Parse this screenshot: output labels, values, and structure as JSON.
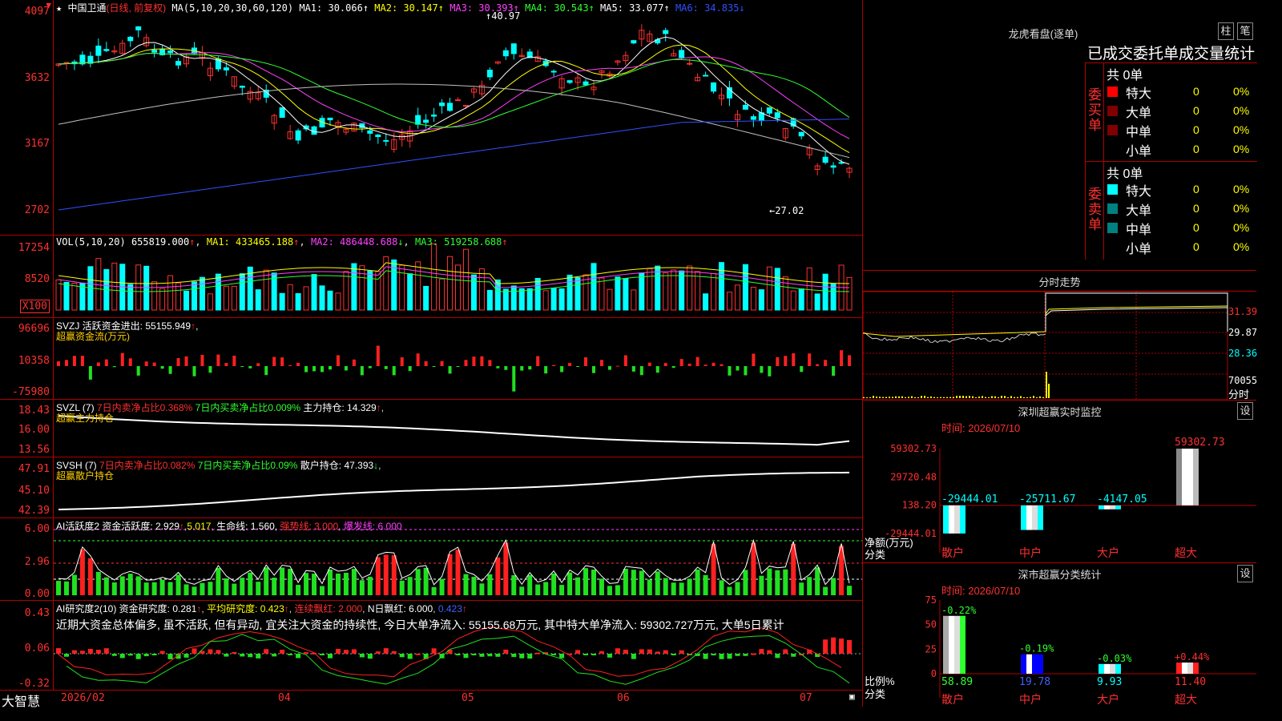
{
  "main": {
    "star": "★",
    "name": "中国卫通",
    "period": "(日线, 前复权)",
    "ma_label": "MA(5,10,20,30,60,120)",
    "ma": [
      {
        "label": "MA1:",
        "value": "30.066",
        "arrow": "↑",
        "color": "#ffffff"
      },
      {
        "label": "MA2:",
        "value": "30.147",
        "arrow": "↑",
        "color": "#ffff00"
      },
      {
        "label": "MA3:",
        "value": "30.393",
        "arrow": "↑",
        "color": "#ff40ff"
      },
      {
        "label": "MA4:",
        "value": "30.543",
        "arrow": "↑",
        "color": "#30ff30"
      },
      {
        "label": "MA5:",
        "value": "33.077",
        "arrow": "↑",
        "color": "#ffffff"
      },
      {
        "label": "MA6:",
        "value": "34.835",
        "arrow": "↓",
        "color": "#3050ff"
      }
    ],
    "y_ticks": [
      "4097",
      "3632",
      "3167",
      "2702"
    ],
    "high_label": "40.97",
    "low_label": "←27.02"
  },
  "vol": {
    "title": "VOL(5,10,20)",
    "value": "655819.000",
    "ma1": "MA1: 433465.188",
    "ma2": "MA2: 486448.688",
    "ma3": "MA3: 519258.688",
    "y_ticks": [
      "17254",
      "8520"
    ],
    "unit": "X100"
  },
  "svzj": {
    "title": "SVZJ  活跃资金进出: 55155.949",
    "sub": "超赢资金流(万元)",
    "y_ticks": [
      "96696",
      "10358",
      "-75980"
    ]
  },
  "svzl": {
    "title_a": "SVZL (7)",
    "title_b": "7日内卖净占比0.368%",
    "title_c": "7日内买卖净占比0.009%",
    "title_d": "主力持仓: 14.329",
    "sub": "超赢主力持仓",
    "y_ticks": [
      "18.43",
      "16.00",
      "13.56"
    ]
  },
  "svsh": {
    "title_a": "SVSH (7)",
    "title_b": "7日内卖净占比0.082%",
    "title_c": "7日内买卖净占比0.09%",
    "title_d": "散户持仓: 47.393",
    "sub": "超赢散户持仓",
    "y_ticks": [
      "47.91",
      "45.10",
      "42.39"
    ]
  },
  "ai2": {
    "title": "AI活跃度2 资金活跃度: 2.929",
    "v2": "5.017",
    "life": "生命线: 1.560",
    "strong": "强势线: 3.000",
    "burst": "爆发线: 6.000",
    "y_ticks": [
      "6.00",
      "2.96",
      "0.00"
    ]
  },
  "ai_research": {
    "title": "AI研究度2(10) 资金研究度: 0.281",
    "avg": "平均研究度: 0.423",
    "cont": "连续飘红: 2.000",
    "nday": "N日飘红: 6.000",
    "v": "0.423",
    "desc": "近期大资金总体偏多, 虽不活跃, 但有异动, 宜关注大资金的持续性, 今日大单净流入: 55155.68万元, 其中特大单净流入: 59302.727万元, 大单5日累计",
    "y_ticks": [
      "0.43",
      "0.06",
      "-0.32"
    ]
  },
  "xaxis": {
    "brand": "大智慧",
    "labels": [
      "2026/02",
      "04",
      "05",
      "06",
      "07"
    ]
  },
  "lhb": {
    "title": "龙虎看盘(逐单)",
    "tab1": "柱",
    "tab2": "笔",
    "subtitle": "已成交委托单成交量统计",
    "buy_side": "委买单",
    "sell_side": "委卖单",
    "buy_total": "共 0单",
    "sell_total": "共 0单",
    "buy_rows": [
      {
        "name": "特大",
        "count": "0",
        "pct": "0%",
        "color": "#ff0000"
      },
      {
        "name": "大单",
        "count": "0",
        "pct": "0%",
        "color": "#800000"
      },
      {
        "name": "中单",
        "count": "0",
        "pct": "0%",
        "color": "#800000"
      },
      {
        "name": "小单",
        "count": "0",
        "pct": "0%",
        "color": ""
      }
    ],
    "sell_rows": [
      {
        "name": "特大",
        "count": "0",
        "pct": "0%",
        "color": "#00ffff"
      },
      {
        "name": "大单",
        "count": "0",
        "pct": "0%",
        "color": "#008080"
      },
      {
        "name": "中单",
        "count": "0",
        "pct": "0%",
        "color": "#008080"
      },
      {
        "name": "小单",
        "count": "0",
        "pct": "0%",
        "color": ""
      }
    ]
  },
  "fenshi": {
    "title": "分时走势",
    "prices": [
      "31.39",
      "29.87",
      "28.36"
    ],
    "vol": "70055",
    "vol_label": "分时"
  },
  "monitor": {
    "title": "深圳超赢实时监控",
    "settings": "设",
    "time": "时间: 2026/07/10",
    "y_ticks": [
      "59302.73",
      "29720.48",
      "138.20",
      "-29444.01"
    ],
    "ylabel": "净额(万元)",
    "xlabel": "分类",
    "bars": [
      {
        "cat": "散户",
        "value": -29444.01,
        "label": "-29444.01"
      },
      {
        "cat": "中户",
        "value": -25711.67,
        "label": "-25711.67"
      },
      {
        "cat": "大户",
        "value": -4147.05,
        "label": "-4147.05"
      },
      {
        "cat": "超大",
        "value": 59302.73,
        "label": "59302.73"
      }
    ]
  },
  "classify": {
    "title": "深市超赢分类统计",
    "settings": "设",
    "time": "时间: 2026/07/10",
    "y_ticks": [
      "75",
      "50",
      "25",
      "0"
    ],
    "ylabel": "比例%",
    "xlabel": "分类",
    "bars": [
      {
        "cat": "散户",
        "value": 58.89,
        "label": "58.89",
        "chg": "-0.22%"
      },
      {
        "cat": "中户",
        "value": 19.78,
        "label": "19.78",
        "chg": "-0.19%"
      },
      {
        "cat": "大户",
        "value": 9.93,
        "label": "9.93",
        "chg": "-0.03%"
      },
      {
        "cat": "超大",
        "value": 11.4,
        "label": "11.40",
        "chg": "+0.44%"
      }
    ]
  }
}
